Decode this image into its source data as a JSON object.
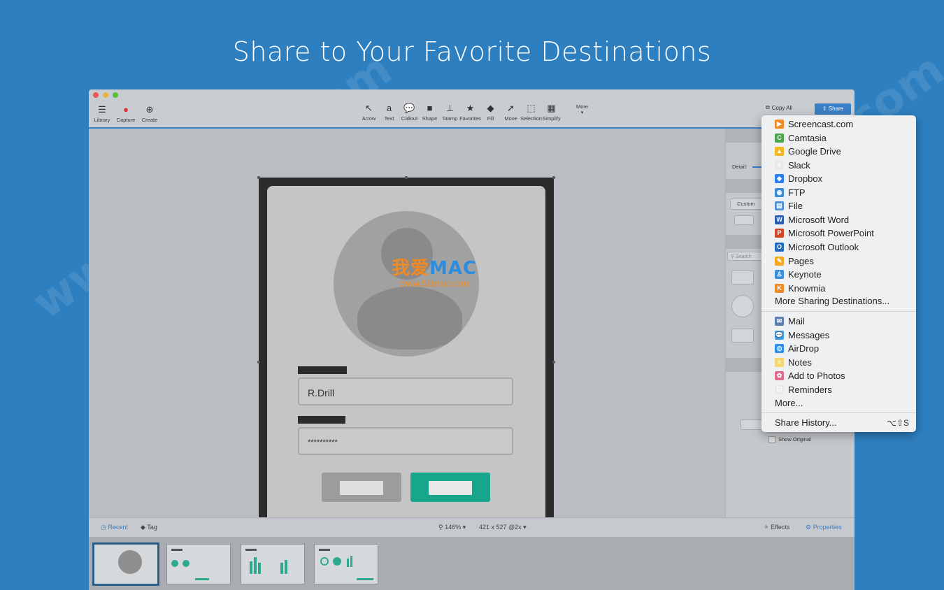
{
  "headline": "Share to Your Favorite Destinations",
  "toolbar": {
    "left": [
      {
        "label": "Library",
        "icon": "list-icon"
      },
      {
        "label": "Capture",
        "icon": "record-icon"
      },
      {
        "label": "Create",
        "icon": "plus-circle-icon"
      }
    ],
    "tools": [
      {
        "label": "Arrow",
        "glyph": "↖"
      },
      {
        "label": "Text",
        "glyph": "a"
      },
      {
        "label": "Callout",
        "glyph": "💬"
      },
      {
        "label": "Shape",
        "glyph": "■"
      },
      {
        "label": "Stamp",
        "glyph": "⊥"
      },
      {
        "label": "Favorites",
        "glyph": "★"
      },
      {
        "label": "Fill",
        "glyph": "◆"
      },
      {
        "label": "Move",
        "glyph": "➚"
      },
      {
        "label": "Selection",
        "glyph": "⬚"
      },
      {
        "label": "Simplify",
        "glyph": "▦"
      }
    ],
    "more_label": "More",
    "copy_all_label": "Copy All",
    "share_label": "Share"
  },
  "side_panel": {
    "detail_label": "Detail:",
    "custom_label": "Custom",
    "search_placeholder": "Search",
    "show_original_label": "Show Original"
  },
  "mockup": {
    "username_value": "R.Drill",
    "password_value": "**********"
  },
  "bottom_bar": {
    "recent_label": "Recent",
    "tag_label": "Tag",
    "zoom": "146% ▾",
    "dimensions": "421 x 527 @2x ▾",
    "effects_label": "Effects",
    "properties_label": "Properties"
  },
  "share_menu": {
    "group1": [
      {
        "label": "Screencast.com",
        "icon": "screencast-icon",
        "color": "#f08a24",
        "glyph": "▶"
      },
      {
        "label": "Camtasia",
        "icon": "camtasia-icon",
        "color": "#4aa64a",
        "glyph": "C"
      },
      {
        "label": "Google Drive",
        "icon": "google-drive-icon",
        "color": "#f3b820",
        "glyph": "▲"
      },
      {
        "label": "Slack",
        "icon": "slack-icon",
        "color": "#e8e8e8",
        "glyph": "#"
      },
      {
        "label": "Dropbox",
        "icon": "dropbox-icon",
        "color": "#2d7ff0",
        "glyph": "◆"
      },
      {
        "label": "FTP",
        "icon": "ftp-icon",
        "color": "#3a8ad8",
        "glyph": "◉"
      },
      {
        "label": "File",
        "icon": "file-icon",
        "color": "#4f8fd6",
        "glyph": "▤"
      },
      {
        "label": "Microsoft Word",
        "icon": "word-icon",
        "color": "#2b5bb0",
        "glyph": "W"
      },
      {
        "label": "Microsoft PowerPoint",
        "icon": "powerpoint-icon",
        "color": "#d24726",
        "glyph": "P"
      },
      {
        "label": "Microsoft Outlook",
        "icon": "outlook-icon",
        "color": "#1f6bc2",
        "glyph": "O"
      },
      {
        "label": "Pages",
        "icon": "pages-icon",
        "color": "#f5a623",
        "glyph": "✎"
      },
      {
        "label": "Keynote",
        "icon": "keynote-icon",
        "color": "#3c8fe0",
        "glyph": "♙"
      },
      {
        "label": "Knowmia",
        "icon": "knowmia-icon",
        "color": "#f08a24",
        "glyph": "K"
      }
    ],
    "more_destinations": "More Sharing Destinations...",
    "group2": [
      {
        "label": "Mail",
        "icon": "mail-icon",
        "color": "#5d7fb0",
        "glyph": "✉"
      },
      {
        "label": "Messages",
        "icon": "messages-icon",
        "color": "#3aa0f0",
        "glyph": "💬"
      },
      {
        "label": "AirDrop",
        "icon": "airdrop-icon",
        "color": "#2f8ee8",
        "glyph": "◎"
      },
      {
        "label": "Notes",
        "icon": "notes-icon",
        "color": "#f5d76e",
        "glyph": "≡"
      },
      {
        "label": "Add to Photos",
        "icon": "photos-icon",
        "color": "#e06a8c",
        "glyph": "✿"
      },
      {
        "label": "Reminders",
        "icon": "reminders-icon",
        "color": "#e9e9e9",
        "glyph": "☑"
      }
    ],
    "more": "More...",
    "history": "Share History...",
    "history_shortcut": "⌥⇧S"
  },
  "watermark": {
    "text": "www.52mac.com",
    "logo_cn": "我爱",
    "logo_mac": "MAC",
    "logo_url": "www.52mac.com"
  },
  "colors": {
    "background": "#2e7fc0",
    "accent": "#3b7fc6",
    "teal_button": "#17a58c"
  }
}
